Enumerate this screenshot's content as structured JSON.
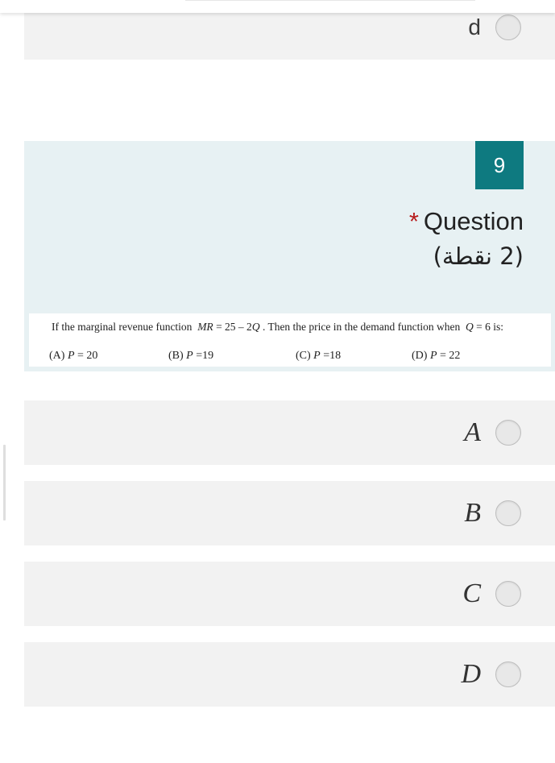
{
  "prev_question": {
    "last_option": {
      "label": "d"
    }
  },
  "question": {
    "number": "9",
    "required_mark": "*",
    "title": "Question",
    "points": "(2 نقطة)",
    "image_text": {
      "line1_pre": "If the marginal revenue function",
      "line1_mr": "MR",
      "line1_eq": "= 25 – 2",
      "line1_q": "Q",
      "line1_mid": ". Then the price in the demand function  when",
      "line1_q2": "Q",
      "line1_post": "= 6 is:",
      "choices": [
        {
          "tag": "(A)",
          "var": "P",
          "value": "= 20"
        },
        {
          "tag": "(B)",
          "var": "P",
          "value": "=19"
        },
        {
          "tag": "(C)",
          "var": "P",
          "value": "=18"
        },
        {
          "tag": "(D)",
          "var": "P",
          "value": "= 22"
        }
      ]
    }
  },
  "options": [
    {
      "label": "A"
    },
    {
      "label": "B"
    },
    {
      "label": "C"
    },
    {
      "label": "D"
    }
  ],
  "colors": {
    "accent": "#0e7a80",
    "question_bg": "#e7f1f3",
    "option_bg": "#f2f2f2",
    "required": "#b71c1c"
  }
}
